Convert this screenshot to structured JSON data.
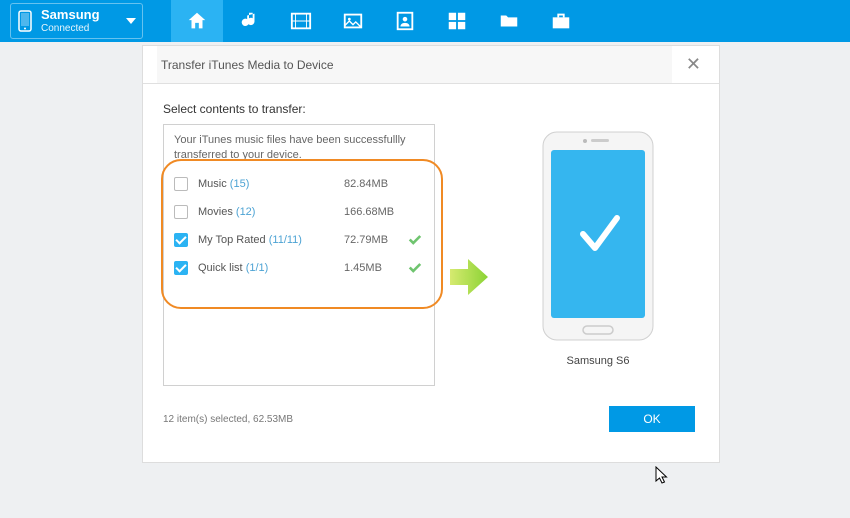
{
  "device": {
    "name": "Samsung",
    "status": "Connected"
  },
  "modal": {
    "title": "Transfer iTunes Media to Device",
    "select_label": "Select contents to transfer:",
    "status_msg": "Your iTunes music files have been successfullly transferred to your device.",
    "rows": [
      {
        "label": "Music",
        "count": "(15)",
        "size": "82.84MB",
        "checked": false,
        "done": false
      },
      {
        "label": "Movies",
        "count": "(12)",
        "size": "166.68MB",
        "checked": false,
        "done": false
      },
      {
        "label": "My Top Rated",
        "count": "(11/11)",
        "size": "72.79MB",
        "checked": true,
        "done": true
      },
      {
        "label": "Quick list",
        "count": "(1/1)",
        "size": "1.45MB",
        "checked": true,
        "done": true
      }
    ],
    "target_device": "Samsung S6",
    "summary": "12 item(s) selected, 62.53MB",
    "ok_label": "OK"
  }
}
